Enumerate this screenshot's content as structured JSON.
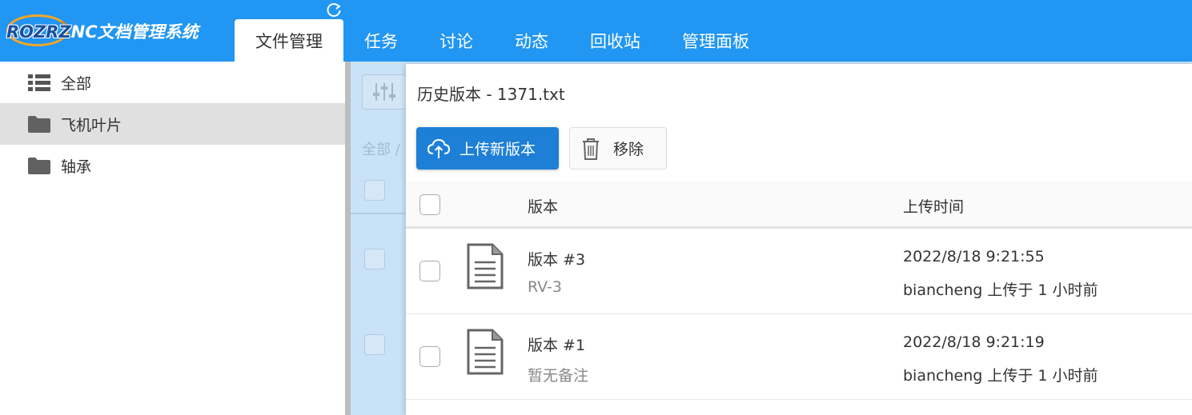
{
  "app": {
    "logo_brand": "ROZRZ",
    "logo_rest": "NC文档管理系统"
  },
  "nav": {
    "tabs": [
      {
        "label": "文件管理",
        "active": true
      },
      {
        "label": "任务"
      },
      {
        "label": "讨论"
      },
      {
        "label": "动态"
      },
      {
        "label": "回收站"
      },
      {
        "label": "管理面板"
      }
    ]
  },
  "sidebar": {
    "items": [
      {
        "label": "全部",
        "icon": "list-icon"
      },
      {
        "label": "飞机叶片",
        "icon": "folder-icon",
        "selected": true
      },
      {
        "label": "轴承",
        "icon": "folder-icon"
      }
    ]
  },
  "background": {
    "breadcrumb": "全部 /"
  },
  "dialog": {
    "title": "历史版本 - 1371.txt",
    "upload_label": "上传新版本",
    "remove_label": "移除",
    "columns": {
      "version": "版本",
      "upload_time": "上传时间"
    },
    "rows": [
      {
        "version": "版本 #3",
        "note": "RV-3",
        "time": "2022/8/18 9:21:55",
        "uploaded_by": "biancheng 上传于 1 小时前"
      },
      {
        "version": "版本 #1",
        "note": "暂无备注",
        "time": "2022/8/18 9:21:19",
        "uploaded_by": "biancheng 上传于 1 小时前"
      }
    ]
  },
  "colors": {
    "topbar": "#2196f3",
    "primary_button": "#1e7fd6",
    "selected_sidebar": "#e0e0e0"
  }
}
